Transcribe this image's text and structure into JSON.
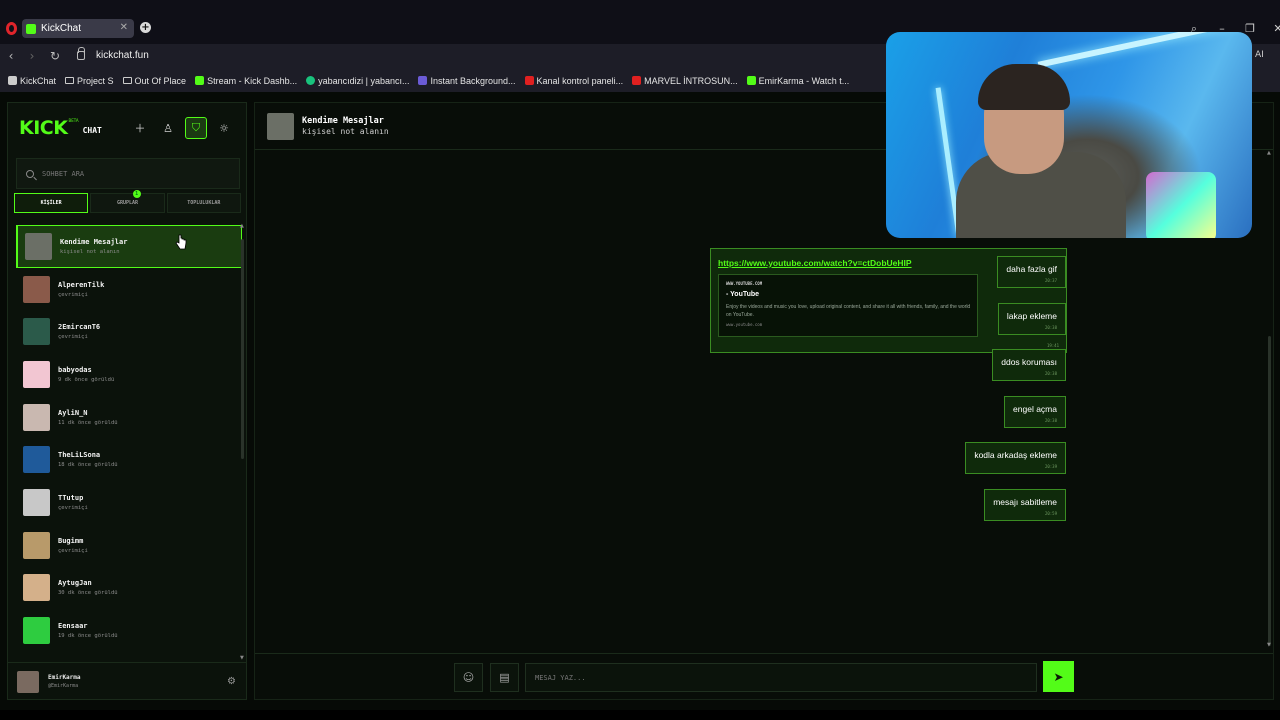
{
  "browser": {
    "tab_title": "KickChat",
    "url": "kickchat.fun",
    "ai_label": "AI",
    "bookmarks": [
      {
        "label": "KickChat",
        "icon": "page-icon"
      },
      {
        "label": "Project S",
        "icon": "folder-icon"
      },
      {
        "label": "Out Of Place",
        "icon": "folder-icon"
      },
      {
        "label": "Stream - Kick Dashb...",
        "icon": "kick-icon"
      },
      {
        "label": "yabancıdizi | yabancı...",
        "icon": "v-icon"
      },
      {
        "label": "Instant Background...",
        "icon": "p-icon"
      },
      {
        "label": "Kanal kontrol paneli...",
        "icon": "youtube-icon"
      },
      {
        "label": "MARVEL İNTROSUN...",
        "icon": "youtube-icon"
      },
      {
        "label": "EmirKarma - Watch t...",
        "icon": "kick-icon"
      }
    ]
  },
  "sidebar": {
    "logo": "KICK",
    "beta": "BETA",
    "chat": "CHAT",
    "search_placeholder": "SOHBET ARA",
    "tabs": [
      "KİŞİLER",
      "GRUPLAR",
      "TOPLULUKLAR"
    ],
    "groups_badge": "1",
    "contacts": [
      {
        "name": "Kendime Mesajlar",
        "status": "kişisel not alanın",
        "color": "#6b6f66"
      },
      {
        "name": "AlperenTilk",
        "status": "çevrimiçi",
        "color": "#8a5a4a"
      },
      {
        "name": "2EmircanT6",
        "status": "çevrimiçi",
        "color": "#2b5a4a"
      },
      {
        "name": "babyodas",
        "status": "9 dk önce görüldü",
        "color": "#f2c6d2"
      },
      {
        "name": "AyliN_N",
        "status": "11 dk önce görüldü",
        "color": "#c9b8b0"
      },
      {
        "name": "TheLiLSona",
        "status": "18 dk önce görüldü",
        "color": "#1f5a9a"
      },
      {
        "name": "TTutup",
        "status": "çevrimiçi",
        "color": "#c8c8c8"
      },
      {
        "name": "Bugimm",
        "status": "çevrimiçi",
        "color": "#b89a6a"
      },
      {
        "name": "AytugJan",
        "status": "30 dk önce görüldü",
        "color": "#d4b08a"
      },
      {
        "name": "Eensaar",
        "status": "19 dk önce görüldü",
        "color": "#2ecc40"
      }
    ],
    "me": {
      "name": "EmirKarma",
      "handle": "@EmirKarma"
    }
  },
  "chat": {
    "header_name": "Kendime Mesajlar",
    "header_sub": "kişisel not alanın",
    "link_message": {
      "url": "https://www.youtube.com/watch?v=ctDobUeHIP",
      "preview_domain": "WWW.YOUTUBE.COM",
      "preview_title": "- YouTube",
      "preview_desc": "Enjoy the videos and music you love, upload original content, and share it all with friends, family, and the world on YouTube.",
      "preview_footer": "www.youtube.com",
      "time": "19:41"
    },
    "messages": [
      {
        "text": "daha fazla gif",
        "time": "20:37"
      },
      {
        "text": "lakap ekleme",
        "time": "20:38"
      },
      {
        "text": "ddos koruması",
        "time": "20:38"
      },
      {
        "text": "engel açma",
        "time": "20:38"
      },
      {
        "text": "kodla arkadaş ekleme",
        "time": "20:39"
      },
      {
        "text": "mesajı sabitleme",
        "time": "20:59"
      }
    ],
    "input_placeholder": "MESAJ YAZ..."
  }
}
